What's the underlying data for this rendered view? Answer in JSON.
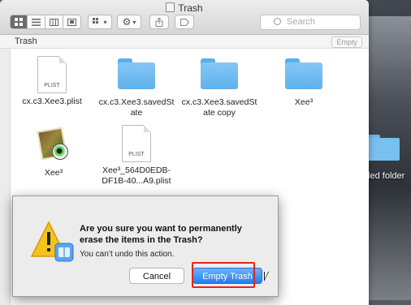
{
  "window": {
    "title": "Trash",
    "toolbar": {
      "view_buttons": [
        "icon-view",
        "list-view",
        "column-view",
        "cover-flow-view"
      ],
      "arrange_icon": "grid-icon",
      "action_icon": "gear-icon",
      "share_icon": "share-icon",
      "tag_icon": "tag-icon",
      "search_placeholder": "Search"
    },
    "pathbar": {
      "location": "Trash",
      "empty_button": "Empty"
    }
  },
  "items": [
    {
      "name": "cx.c3.Xee3.plist",
      "icon": "plist-file-icon",
      "badge": "PLIST"
    },
    {
      "name": "cx.c3.Xee3.savedSt ate",
      "icon": "folder-icon"
    },
    {
      "name": "cx.c3.Xee3.savedSt ate copy",
      "icon": "folder-icon"
    },
    {
      "name": "Xee³",
      "icon": "folder-icon"
    },
    {
      "name": "Xee³",
      "icon": "xee-app-icon"
    },
    {
      "name": "Xee³_564D0EDB-DF1B-40...A9.plist",
      "icon": "plist-file-icon",
      "badge": "PLIST"
    }
  ],
  "dialog": {
    "title": "Are you sure you want to permanently erase the items in the Trash?",
    "message": "You can’t undo this action.",
    "cancel": "Cancel",
    "confirm": "Empty Trash",
    "confirm_color": "#1f7ff0"
  },
  "desktop": {
    "folder_label": "tled folder"
  },
  "highlight_color": "#e0241f"
}
